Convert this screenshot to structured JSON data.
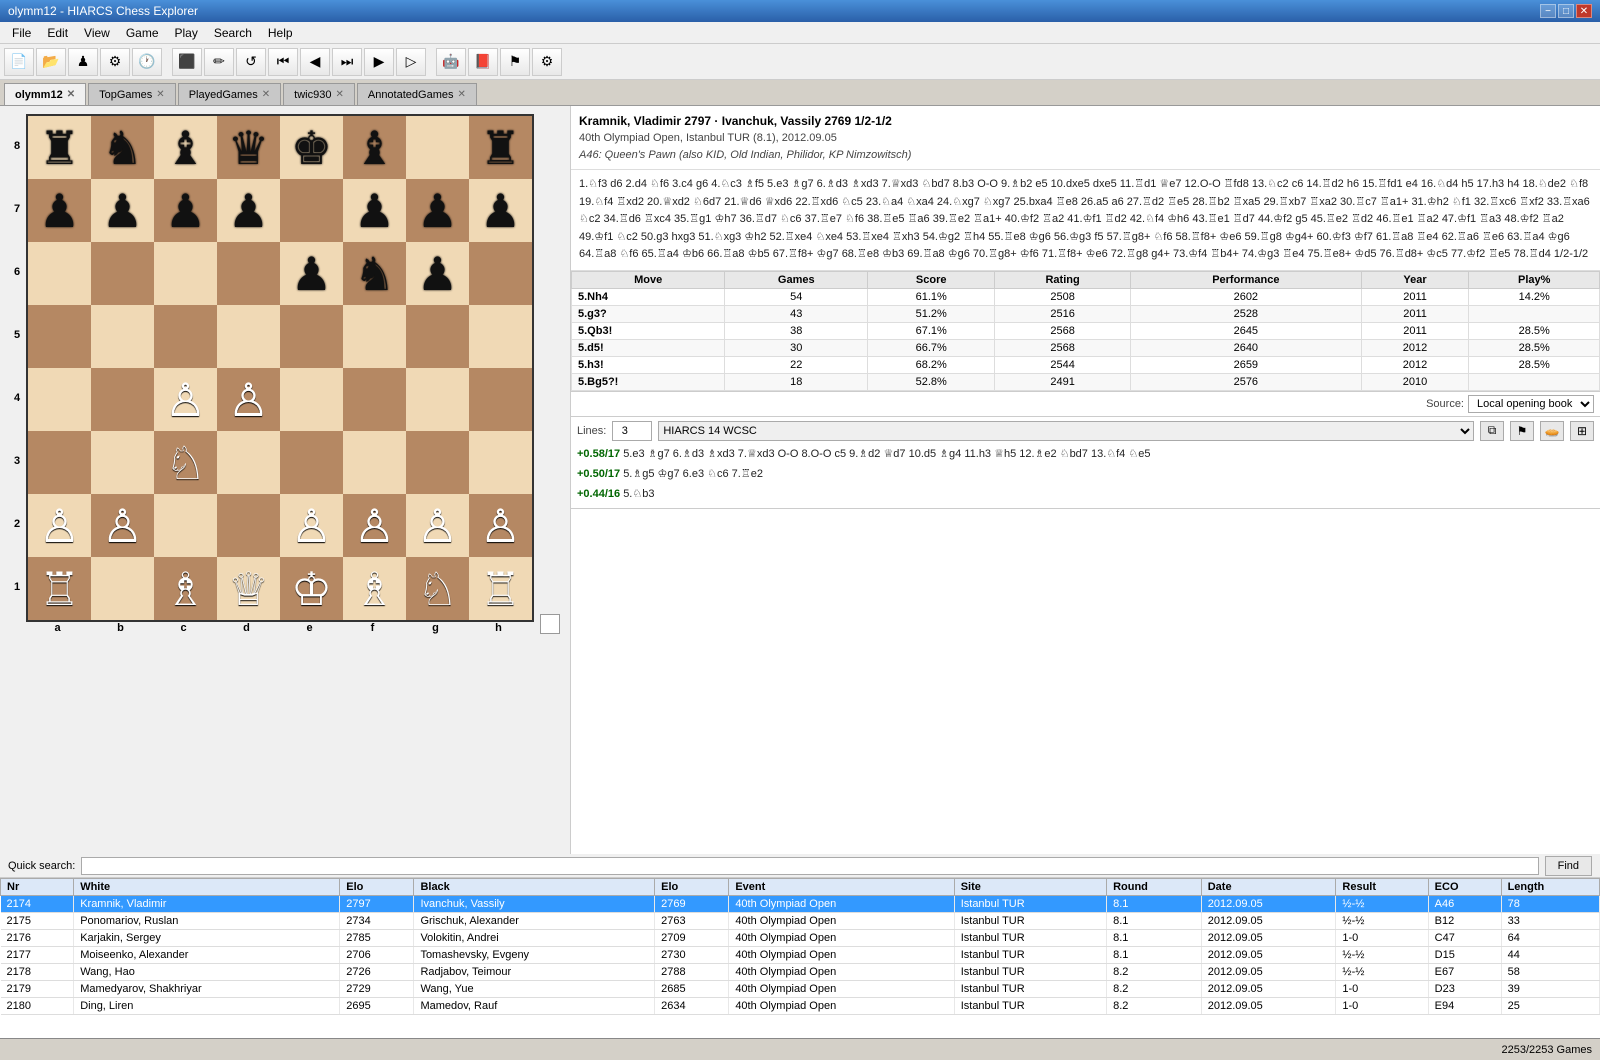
{
  "titlebar": {
    "title": "olymm12 - HIARCS Chess Explorer",
    "btn_min": "−",
    "btn_max": "□",
    "btn_close": "✕"
  },
  "menubar": {
    "items": [
      "File",
      "Edit",
      "View",
      "Game",
      "Play",
      "Search",
      "Help"
    ]
  },
  "tabs": [
    {
      "label": "olymm12",
      "active": true
    },
    {
      "label": "TopGames",
      "active": false
    },
    {
      "label": "PlayedGames",
      "active": false
    },
    {
      "label": "twic930",
      "active": false
    },
    {
      "label": "AnnotatedGames",
      "active": false
    }
  ],
  "game_info": {
    "title": "Kramnik, Vladimir 2797 · Ivanchuk, Vassily 2769  1/2-1/2",
    "event": "40th Olympiad Open, Istanbul TUR (8.1), 2012.09.05",
    "opening": "A46: Queen's Pawn (also KID, Old Indian, Philidor, KP Nimzowitsch)"
  },
  "move_text": "1.♘f3 d6 2.d4 ♘f6 3.c4 g6 4.♘c3 ♗f5 5.e3 ♗g7 6.♗d3 ♗xd3 7.♕xd3 ♘bd7 8.b3 O-O 9.♗b2 e5 10.dxe5 dxe5 11.♖d1 ♕e7 12.O-O ♖fd8 13.♘c2 c6 14.♖d2 h6 15.♖fd1 e4 16.♘d4 h5 17.h3 h4 18.♘de2 ♘f8 19.♘f4 ♖xd2 20.♕xd2 ♘6d7 21.♕d6 ♕xd6 22.♖xd6 ♘c5 23.♘a4 ♘xa4 24.♘xg7 ♘xg7 25.bxa4 ♖e8 26.a5 a6 27.♖d2 ♖e5 28.♖b2 ♖xa5 29.♖xb7 ♖xa2 30.♖c7 ♖a1+ 31.♔h2 ♘f1 32.♖xc6 ♖xf2 33.♖xa6 ♘c2 34.♖d6 ♖xc4 35.♖g1 ♔h7 36.♖d7 ♘c6 37.♖e7 ♘f6 38.♖e5 ♖a6 39.♖e2 ♖a1+ 40.♔f2 ♖a2 41.♔f1 ♖d2 42.♘f4 ♔h6 43.♖e1 ♖d7 44.♔f2 g5 45.♖e2 ♖d2 46.♖e1 ♖a2 47.♔f1 ♖a3 48.♔f2 ♖a2 49.♔f1 ♘c2 50.g3 hxg3 51.♘xg3 ♔h2 52.♖xe4 ♘xe4 53.♖xe4 ♖xh3 54.♔g2 ♖h4 55.♖e8 ♔g6 56.♔g3 f5 57.♖g8+ ♘f6 58.♖f8+ ♔e6 59.♖g8 ♔g4+ 60.♔f3 ♔f7 61.♖a8 ♖e4 62.♖a6 ♖e6 63.♖a4 ♔g6 64.♖a8 ♘f6 65.♖a4 ♔b6 66.♖a8 ♔b5 67.♖f8+ ♔g7 68.♖e8 ♔b3 69.♖a8 ♔g6 70.♖g8+ ♔f6 71.♖f8+ ♔e6 72.♖g8 g4+ 73.♔f4 ♖b4+ 74.♔g3 ♖e4 75.♖e8+ ♔d5 76.♖d8+ ♔c5 77.♔f2 ♖e5 78.♖d4 1/2-1/2",
  "book_table": {
    "headers": [
      "Move",
      "Games",
      "Score",
      "Rating",
      "Performance",
      "Year",
      "Play%"
    ],
    "rows": [
      {
        "move": "5.Nh4",
        "games": 54,
        "score": "61.1%",
        "rating": 2508,
        "performance": 2602,
        "year": 2011,
        "play": "14.2%"
      },
      {
        "move": "5.g3?",
        "games": 43,
        "score": "51.2%",
        "rating": 2516,
        "performance": 2528,
        "year": 2011,
        "play": ""
      },
      {
        "move": "5.Qb3!",
        "games": 38,
        "score": "67.1%",
        "rating": 2568,
        "performance": 2645,
        "year": 2011,
        "play": "28.5%"
      },
      {
        "move": "5.d5!",
        "games": 30,
        "score": "66.7%",
        "rating": 2568,
        "performance": 2640,
        "year": 2012,
        "play": "28.5%"
      },
      {
        "move": "5.h3!",
        "games": 22,
        "score": "68.2%",
        "rating": 2544,
        "performance": 2659,
        "year": 2012,
        "play": "28.5%"
      },
      {
        "move": "5.Bg5?!",
        "games": 18,
        "score": "52.8%",
        "rating": 2491,
        "performance": 2576,
        "year": 2010,
        "play": ""
      }
    ]
  },
  "source": {
    "label": "Source:",
    "value": "Local opening book"
  },
  "engine": {
    "lines_label": "Lines:",
    "lines_value": "3",
    "engine_name": "HIARCS 14 WCSC",
    "line1_eval": "+0.58/17",
    "line1_moves": "5.e3 ♗g7 6.♗d3 ♗xd3 7.♕xd3 O-O 8.O-O c5 9.♗d2 ♕d7 10.d5 ♗g4 11.h3 ♕h5 12.♗e2 ♘bd7 13.♘f4 ♘e5",
    "line2_eval": "+0.50/17",
    "line2_moves": "5.♗g5 ♔g7 6.e3 ♘c6 7.♖e2",
    "line3_eval": "+0.44/16",
    "line3_moves": "5.♘b3"
  },
  "search": {
    "label": "Quick search:",
    "placeholder": "",
    "find_btn": "Find"
  },
  "game_list": {
    "headers": [
      "Nr",
      "White",
      "Elo",
      "Black",
      "Elo",
      "Event",
      "Site",
      "Round",
      "Date",
      "Result",
      "ECO",
      "Length"
    ],
    "rows": [
      {
        "nr": 2174,
        "white": "Kramnik, Vladimir",
        "elo_w": 2797,
        "black": "Ivanchuk, Vassily",
        "elo_b": 2769,
        "event": "40th Olympiad Open",
        "site": "Istanbul TUR",
        "round": "8.1",
        "date": "2012.09.05",
        "result": "½-½",
        "eco": "A46",
        "length": 78,
        "selected": true
      },
      {
        "nr": 2175,
        "white": "Ponomariov, Ruslan",
        "elo_w": 2734,
        "black": "Grischuk, Alexander",
        "elo_b": 2763,
        "event": "40th Olympiad Open",
        "site": "Istanbul TUR",
        "round": "8.1",
        "date": "2012.09.05",
        "result": "½-½",
        "eco": "B12",
        "length": 33
      },
      {
        "nr": 2176,
        "white": "Karjakin, Sergey",
        "elo_w": 2785,
        "black": "Volokitin, Andrei",
        "elo_b": 2709,
        "event": "40th Olympiad Open",
        "site": "Istanbul TUR",
        "round": "8.1",
        "date": "2012.09.05",
        "result": "1-0",
        "eco": "C47",
        "length": 64
      },
      {
        "nr": 2177,
        "white": "Moiseenko, Alexander",
        "elo_w": 2706,
        "black": "Tomashevsky, Evgeny",
        "elo_b": 2730,
        "event": "40th Olympiad Open",
        "site": "Istanbul TUR",
        "round": "8.1",
        "date": "2012.09.05",
        "result": "½-½",
        "eco": "D15",
        "length": 44
      },
      {
        "nr": 2178,
        "white": "Wang, Hao",
        "elo_w": 2726,
        "black": "Radjabov, Teimour",
        "elo_b": 2788,
        "event": "40th Olympiad Open",
        "site": "Istanbul TUR",
        "round": "8.2",
        "date": "2012.09.05",
        "result": "½-½",
        "eco": "E67",
        "length": 58
      },
      {
        "nr": 2179,
        "white": "Mamedyarov, Shakhriyar",
        "elo_w": 2729,
        "black": "Wang, Yue",
        "elo_b": 2685,
        "event": "40th Olympiad Open",
        "site": "Istanbul TUR",
        "round": "8.2",
        "date": "2012.09.05",
        "result": "1-0",
        "eco": "D23",
        "length": 39
      },
      {
        "nr": 2180,
        "white": "Ding, Liren",
        "elo_w": 2695,
        "black": "Mamedov, Rauf",
        "elo_b": 2634,
        "event": "40th Olympiad Open",
        "site": "Istanbul TUR",
        "round": "8.2",
        "date": "2012.09.05",
        "result": "1-0",
        "eco": "E94",
        "length": 25
      }
    ]
  },
  "statusbar": {
    "text": "2253/2253 Games"
  },
  "board": {
    "position": [
      [
        "r",
        "n",
        "b",
        "q",
        "k",
        "b",
        ".",
        "r"
      ],
      [
        "p",
        "p",
        "p",
        "p",
        ".",
        "p",
        "p",
        "p"
      ],
      [
        ".",
        ".",
        ".",
        ".",
        "p",
        "n",
        "p",
        "."
      ],
      [
        ".",
        ".",
        ".",
        ".",
        ".",
        ".",
        ".",
        "."
      ],
      [
        ".",
        ".",
        "P",
        "P",
        ".",
        ".",
        ".",
        "."
      ],
      [
        ".",
        ".",
        "N",
        ".",
        ".",
        ".",
        ".",
        "."
      ],
      [
        "P",
        "P",
        ".",
        ".",
        "P",
        "P",
        "P",
        "P"
      ],
      [
        "R",
        ".",
        "B",
        "Q",
        "K",
        "B",
        "N",
        "R"
      ]
    ]
  }
}
